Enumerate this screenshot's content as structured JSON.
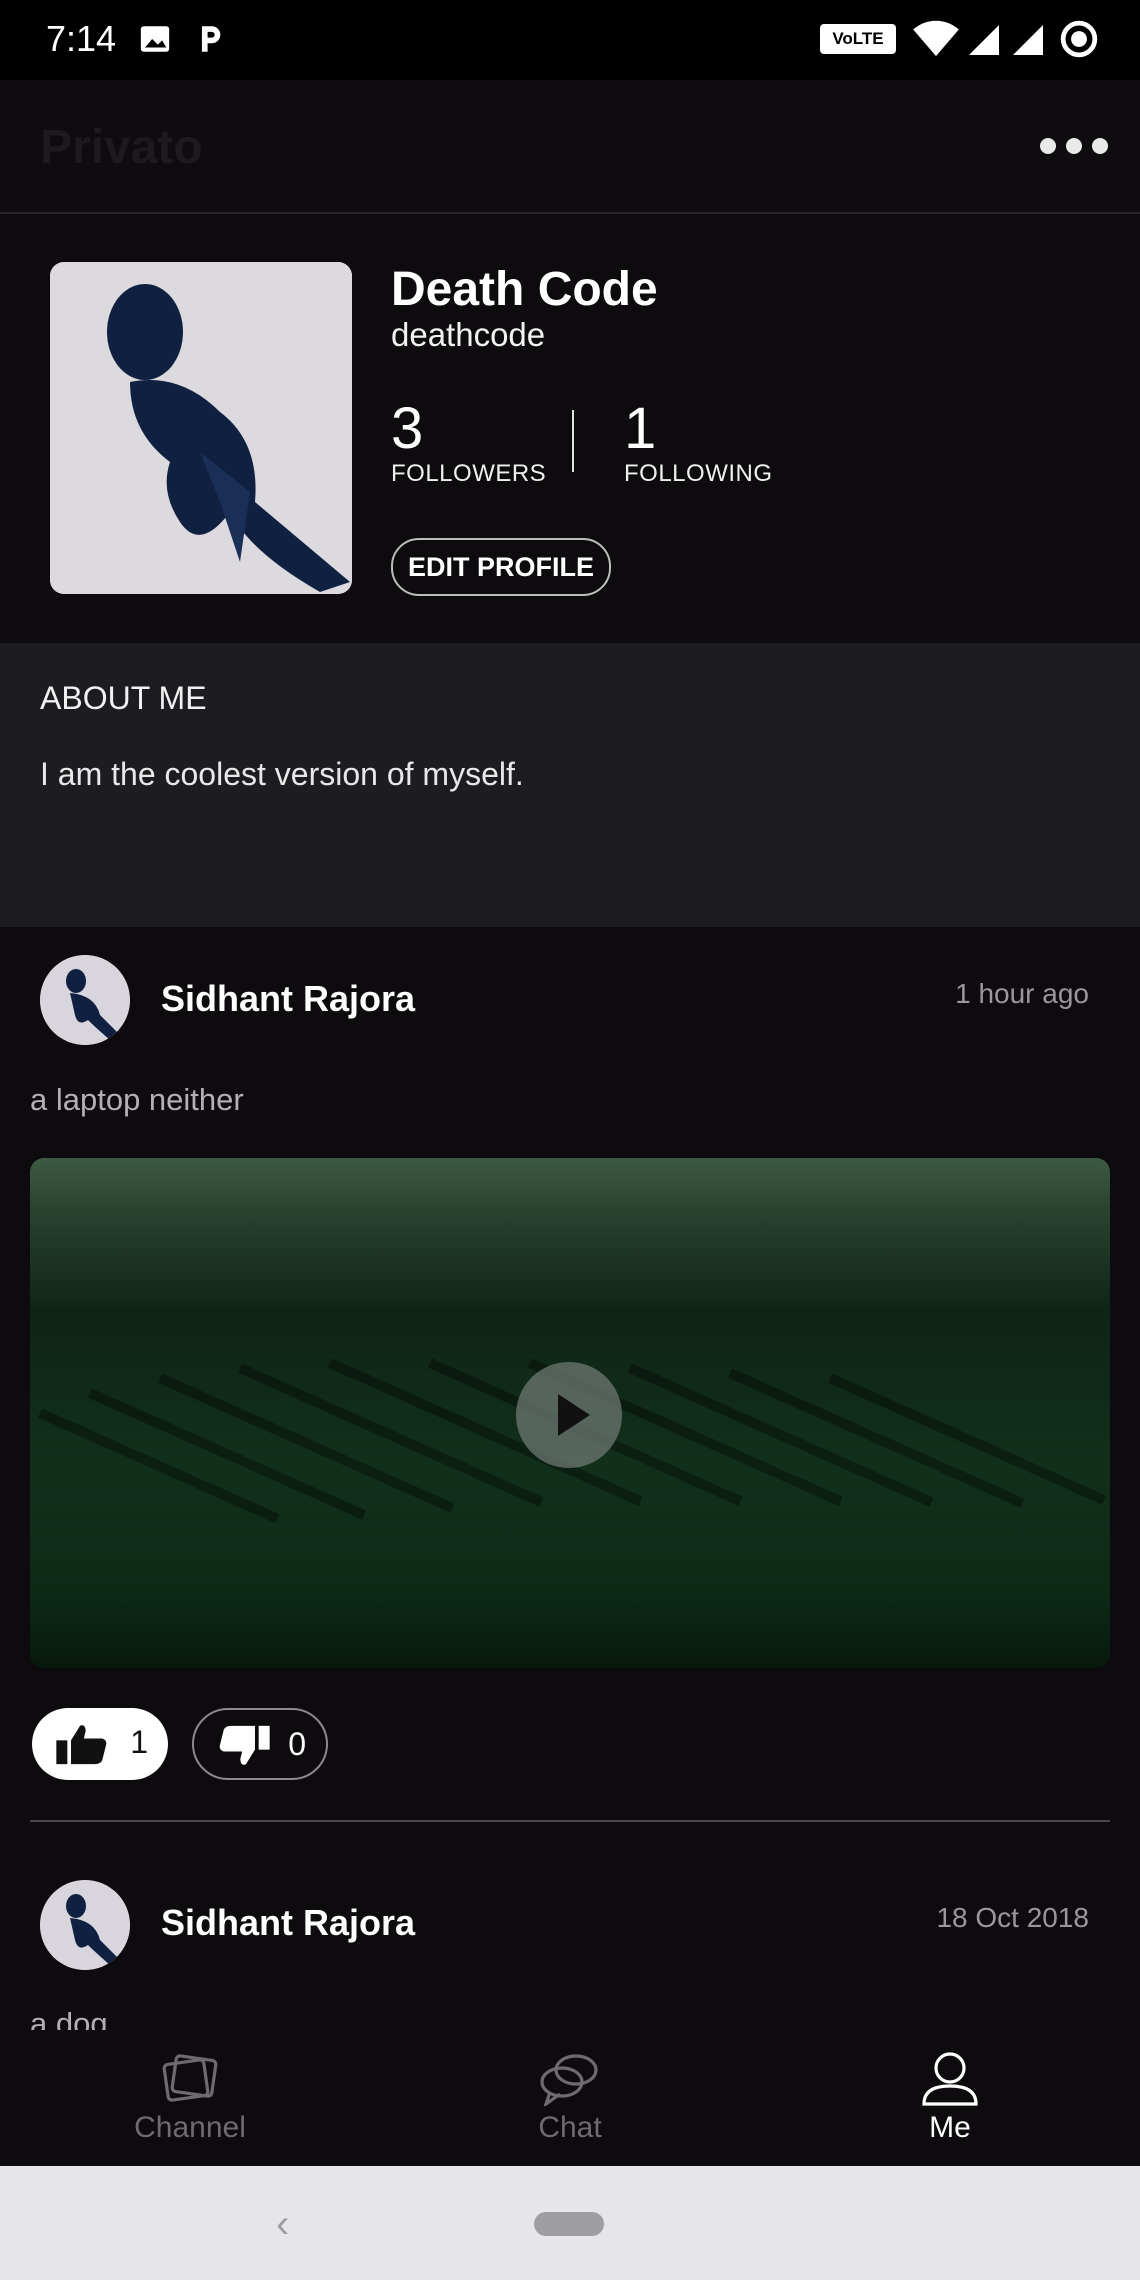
{
  "status_bar": {
    "time": "7:14",
    "volte": "VoLTE"
  },
  "app_bar": {
    "title": "Privato"
  },
  "profile": {
    "display_name": "Death Code",
    "username": "deathcode",
    "followers_count": "3",
    "followers_label": "FOLLOWERS",
    "following_count": "1",
    "following_label": "FOLLOWING",
    "edit_button": "EDIT PROFILE"
  },
  "about": {
    "heading": "ABOUT ME",
    "text": "I am the coolest version of myself."
  },
  "posts": [
    {
      "author": "Sidhant Rajora",
      "time": "1 hour ago",
      "text": "a laptop neither",
      "likes": "1",
      "dislikes": "0"
    },
    {
      "author": "Sidhant Rajora",
      "time": "18 Oct 2018",
      "text": "a dog"
    }
  ],
  "bottom_nav": {
    "items": [
      {
        "label": "Channel",
        "icon": "channel-icon",
        "active": false
      },
      {
        "label": "Chat",
        "icon": "chat-icon",
        "active": false
      },
      {
        "label": "Me",
        "icon": "person-icon",
        "active": true
      }
    ]
  },
  "colors": {
    "background": "#0e0b0f",
    "about_bg": "#1d1c21",
    "muted_text": "#9a979c"
  }
}
